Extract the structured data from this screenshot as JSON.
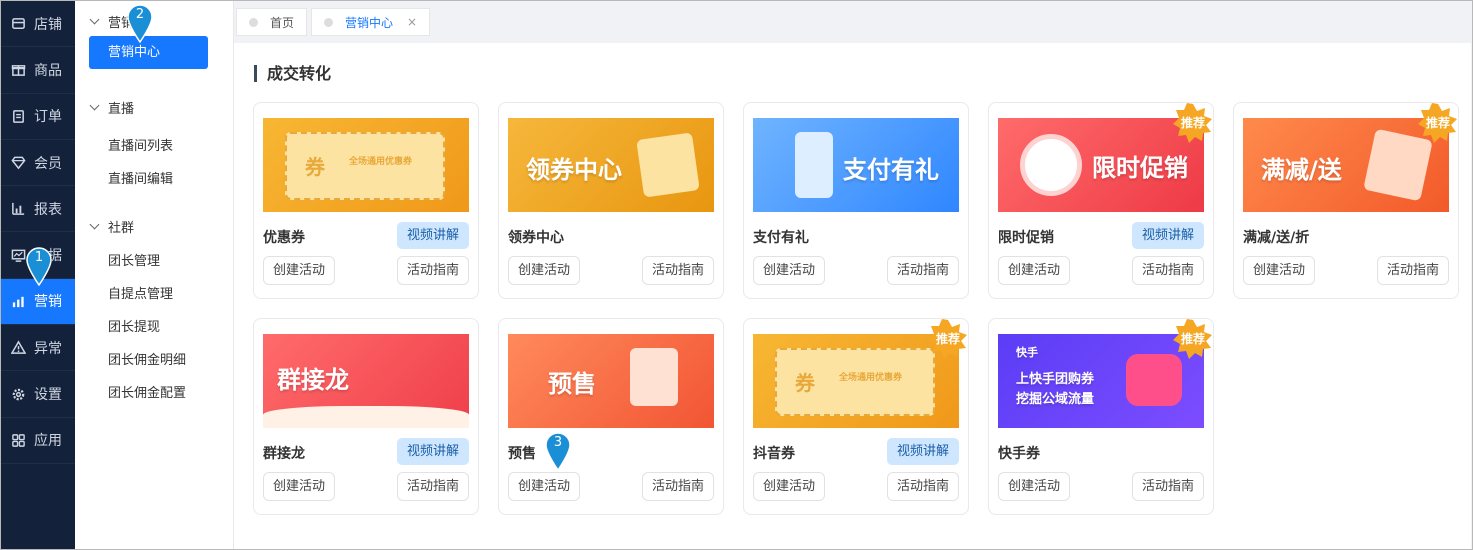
{
  "nav": [
    {
      "label": "店铺",
      "icon": "store-icon"
    },
    {
      "label": "商品",
      "icon": "gift-icon"
    },
    {
      "label": "订单",
      "icon": "clipboard-icon"
    },
    {
      "label": "会员",
      "icon": "diamond-icon"
    },
    {
      "label": "报表",
      "icon": "bar-chart-icon"
    },
    {
      "label": "数据",
      "icon": "data-monitor-icon"
    },
    {
      "label": "营销",
      "icon": "marketing-chart-icon"
    },
    {
      "label": "异常",
      "icon": "warning-icon"
    },
    {
      "label": "设置",
      "icon": "gear-icon"
    },
    {
      "label": "应用",
      "icon": "apps-grid-icon"
    }
  ],
  "sidebar": {
    "groups": [
      {
        "title": "营销",
        "items": [
          "营销中心"
        ]
      },
      {
        "title": "直播",
        "items": [
          "直播间列表",
          "直播间编辑"
        ]
      },
      {
        "title": "社群",
        "items": [
          "团长管理",
          "自提点管理",
          "团长提现",
          "团长佣金明细",
          "团长佣金配置"
        ]
      }
    ]
  },
  "tabs": [
    {
      "label": "首页"
    },
    {
      "label": "营销中心",
      "close": "×"
    }
  ],
  "section": {
    "title": "成交转化"
  },
  "cards": [
    {
      "name": "优惠券",
      "banner_text": "券",
      "banner_sub": "全场通用优惠券",
      "video": "视频讲解",
      "create": "创建活动",
      "guide": "活动指南"
    },
    {
      "name": "领券中心",
      "banner_text": "领券中心",
      "create": "创建活动",
      "guide": "活动指南"
    },
    {
      "name": "支付有礼",
      "banner_text": "支付有礼",
      "create": "创建活动",
      "guide": "活动指南"
    },
    {
      "name": "限时促销",
      "banner_text": "限时促销",
      "video": "视频讲解",
      "badge": "推荐",
      "create": "创建活动",
      "guide": "活动指南"
    },
    {
      "name": "满减/送/折",
      "banner_text": "满减/送",
      "badge": "推荐",
      "create": "创建活动",
      "guide": "活动指南"
    },
    {
      "name": "群接龙",
      "banner_text": "群接龙",
      "video": "视频讲解",
      "create": "创建活动",
      "guide": "活动指南"
    },
    {
      "name": "预售",
      "banner_text": "预售",
      "create": "创建活动",
      "guide": "活动指南"
    },
    {
      "name": "抖音券",
      "banner_text": "券",
      "banner_sub": "全场通用优惠券",
      "video": "视频讲解",
      "badge": "推荐",
      "create": "创建活动",
      "guide": "活动指南"
    },
    {
      "name": "快手券",
      "banner_brand": "快手",
      "banner_line1": "上快手团购券",
      "banner_line2": "挖掘公域流量",
      "badge": "推荐",
      "create": "创建活动",
      "guide": "活动指南"
    }
  ],
  "markers": [
    "1",
    "2",
    "3"
  ],
  "colors": {
    "primary": "#1677ff",
    "nav_bg": "#14213a",
    "badge": "#f5a623",
    "video_btn_bg": "#cfe6ff"
  }
}
